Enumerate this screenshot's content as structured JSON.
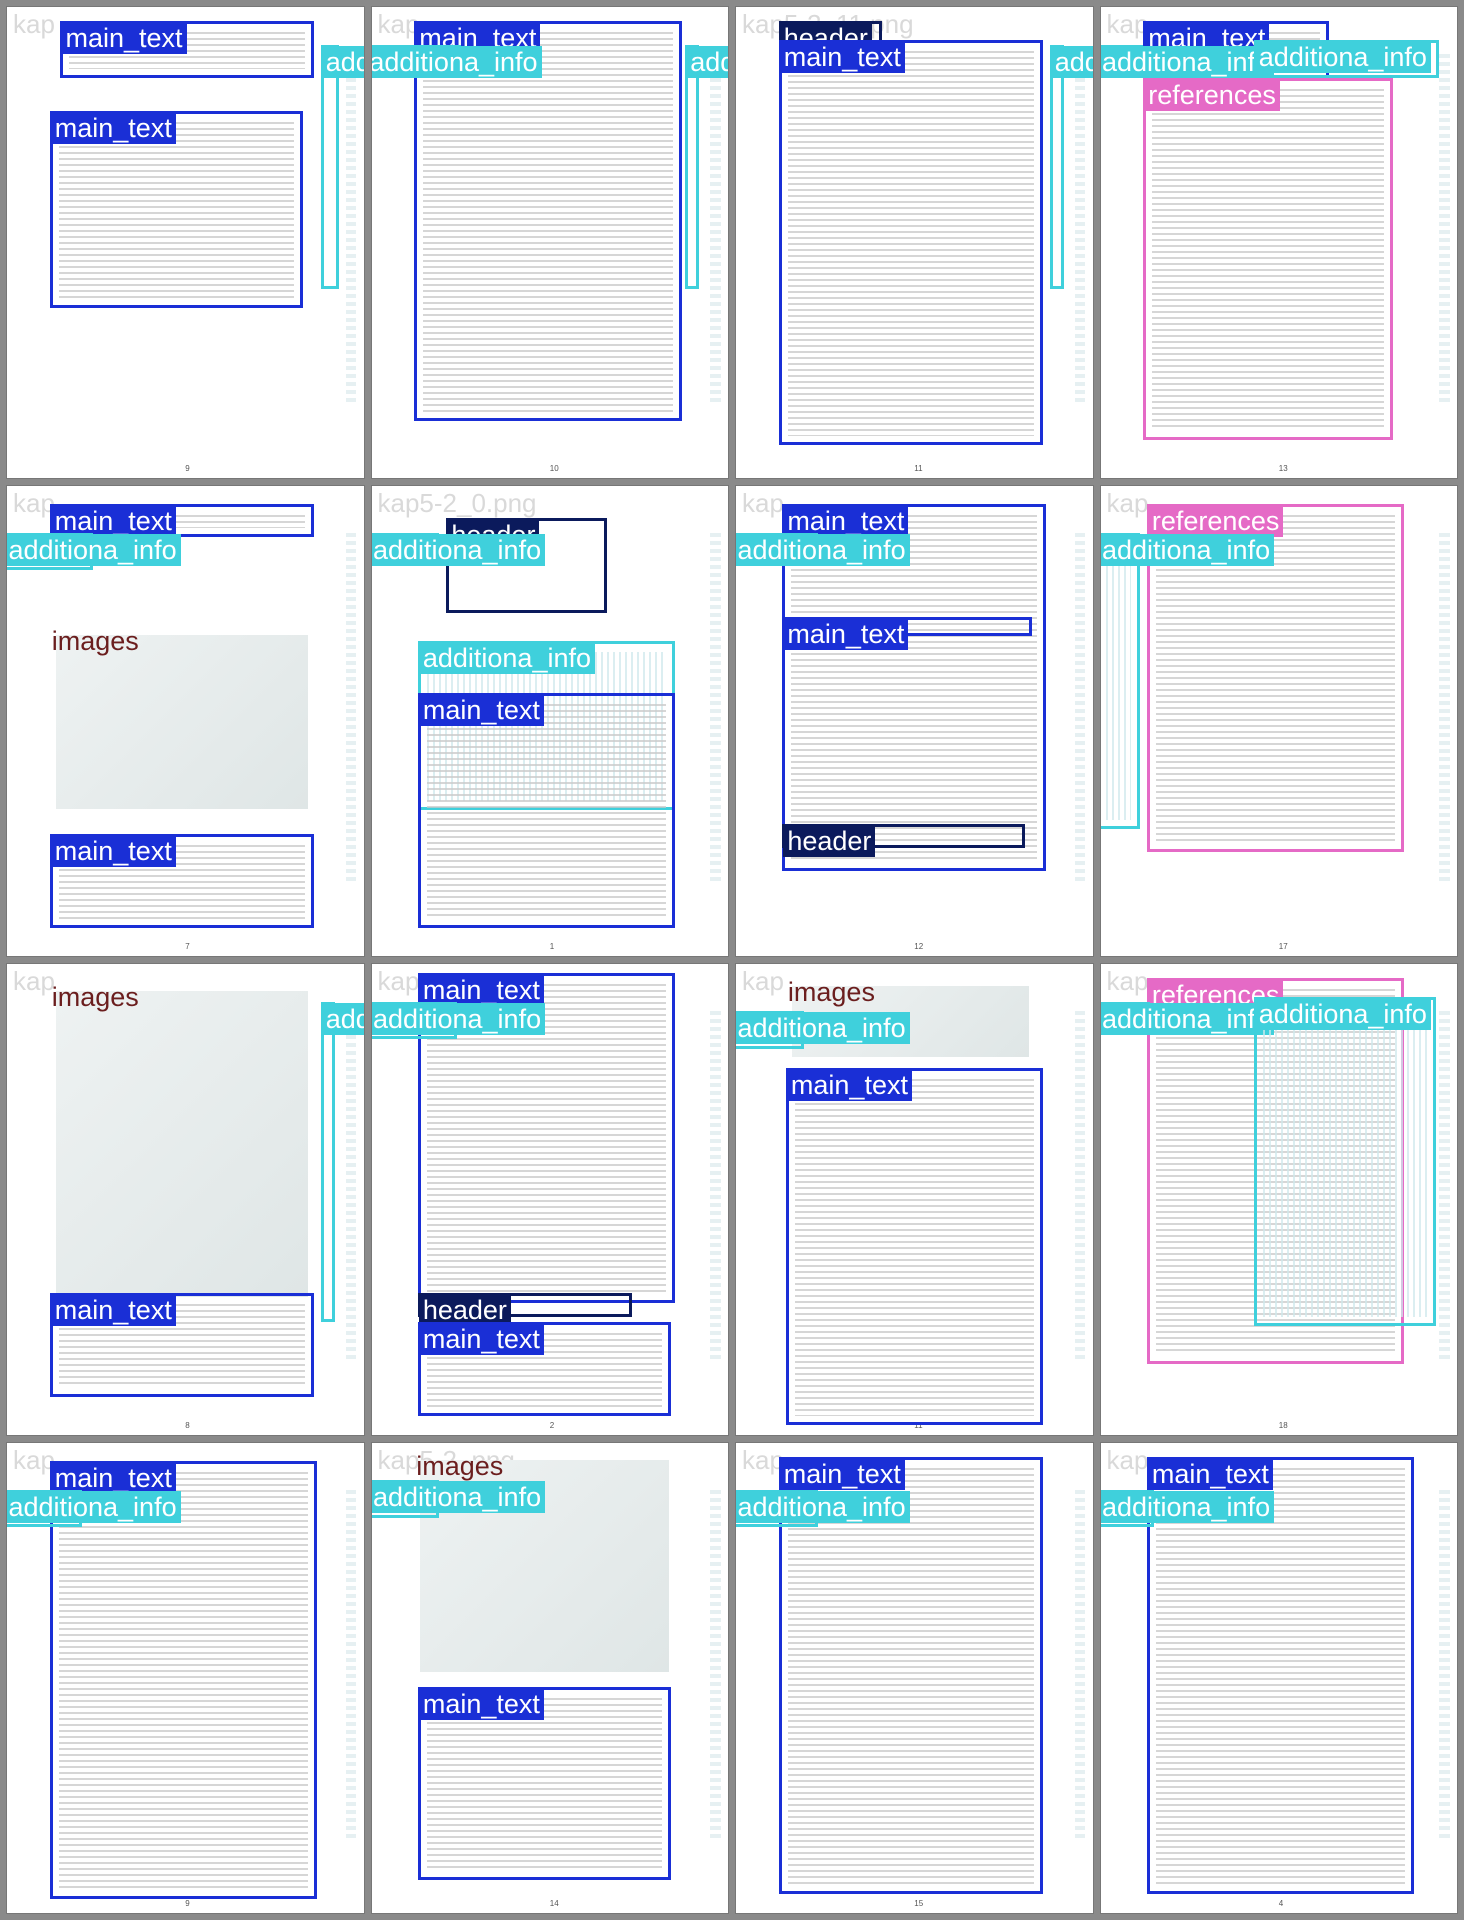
{
  "colors": {
    "main_text": "#1a2fd6",
    "additional_info": "#3fd0dc",
    "references": "#e56ac6",
    "images": "#6b1e1e",
    "header": "#0b1a5c"
  },
  "labels": {
    "main_text": "main_text",
    "additional_info": "additiona_info",
    "references": "references",
    "images": "images",
    "header": "header"
  },
  "tiles": [
    {
      "name": "kap",
      "page_number": "9",
      "regions": [
        {
          "type": "main_text"
        },
        {
          "type": "main_text"
        },
        {
          "type": "additional_info"
        }
      ]
    },
    {
      "name": "kap",
      "page_number": "10",
      "regions": [
        {
          "type": "main_text"
        },
        {
          "type": "additional_info"
        },
        {
          "type": "additional_info"
        }
      ]
    },
    {
      "name": "kap5-2_11.png",
      "page_number": "11",
      "regions": [
        {
          "type": "header"
        },
        {
          "type": "main_text"
        },
        {
          "type": "additional_info"
        }
      ]
    },
    {
      "name": "kap",
      "page_number": "13",
      "regions": [
        {
          "type": "main_text"
        },
        {
          "type": "additional_info"
        },
        {
          "type": "additional_info"
        },
        {
          "type": "references"
        }
      ]
    },
    {
      "name": "kap",
      "page_number": "7",
      "regions": [
        {
          "type": "main_text"
        },
        {
          "type": "additional_info"
        },
        {
          "type": "images"
        },
        {
          "type": "main_text"
        }
      ]
    },
    {
      "name": "kap5-2_0.png",
      "page_number": "1",
      "regions": [
        {
          "type": "header"
        },
        {
          "type": "additional_info"
        },
        {
          "type": "additional_info"
        },
        {
          "type": "main_text"
        }
      ]
    },
    {
      "name": "kap",
      "page_number": "12",
      "regions": [
        {
          "type": "main_text"
        },
        {
          "type": "additional_info"
        },
        {
          "type": "main_text"
        },
        {
          "type": "header"
        }
      ]
    },
    {
      "name": "kap",
      "page_number": "17",
      "regions": [
        {
          "type": "references"
        },
        {
          "type": "additional_info"
        }
      ]
    },
    {
      "name": "kap",
      "page_number": "8",
      "regions": [
        {
          "type": "images"
        },
        {
          "type": "main_text"
        },
        {
          "type": "additional_info"
        }
      ]
    },
    {
      "name": "kap",
      "page_number": "2",
      "regions": [
        {
          "type": "main_text"
        },
        {
          "type": "additional_info"
        },
        {
          "type": "header"
        },
        {
          "type": "main_text"
        }
      ]
    },
    {
      "name": "kap",
      "page_number": "11",
      "regions": [
        {
          "type": "images"
        },
        {
          "type": "additional_info"
        },
        {
          "type": "main_text"
        }
      ]
    },
    {
      "name": "kap",
      "page_number": "18",
      "regions": [
        {
          "type": "references"
        },
        {
          "type": "additional_info"
        },
        {
          "type": "additional_info"
        }
      ]
    },
    {
      "name": "kap",
      "page_number": "9",
      "regions": [
        {
          "type": "main_text"
        },
        {
          "type": "additional_info"
        }
      ]
    },
    {
      "name": "kap5-2_png",
      "page_number": "14",
      "regions": [
        {
          "type": "images"
        },
        {
          "type": "additional_info"
        },
        {
          "type": "main_text"
        }
      ]
    },
    {
      "name": "kap",
      "page_number": "15",
      "regions": [
        {
          "type": "main_text"
        },
        {
          "type": "additional_info"
        }
      ]
    },
    {
      "name": "kap",
      "page_number": "4",
      "regions": [
        {
          "type": "main_text"
        },
        {
          "type": "additional_info"
        }
      ]
    }
  ]
}
